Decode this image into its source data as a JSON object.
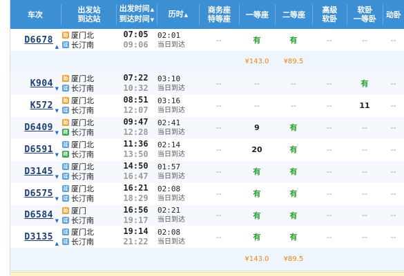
{
  "header": {
    "train_no": "车次",
    "stations_1": "出发站",
    "stations_2": "到达站",
    "times_1": "出发时间",
    "times_2": "到达时间",
    "duration": "历时",
    "business_1": "商务座",
    "business_2": "特等座",
    "first": "一等座",
    "second": "二等座",
    "hsoft_1": "高级",
    "hsoft_2": "软卧",
    "soft_1": "软卧",
    "soft_2": "一等卧",
    "motor": "动卧",
    "sort_up": "▲",
    "sort_down": "▼"
  },
  "badges": {
    "start": "始",
    "pass": "过",
    "end": "终"
  },
  "arrows": {
    "up": "▲",
    "down": "▼"
  },
  "price_rows": [
    {
      "first": "¥143.0",
      "second": "¥89.5"
    },
    {
      "first": "¥143.0",
      "second": "¥89.5"
    }
  ],
  "trains": [
    {
      "no": "D6678",
      "from": "厦门北",
      "to": "长汀南",
      "from_badge": "始",
      "to_badge": "过",
      "dep": "07:05",
      "arr": "09:06",
      "dur": "02:01",
      "day": "当日到达",
      "biz": "--",
      "first": "有",
      "second": "有",
      "hsoft": "--",
      "soft": "--",
      "motor": "--",
      "arrow": "up"
    },
    {
      "no": "K904",
      "from": "厦门北",
      "to": "长汀南",
      "from_badge": "始",
      "to_badge": "过",
      "dep": "07:22",
      "arr": "10:32",
      "dur": "03:10",
      "day": "当日到达",
      "biz": "--",
      "first": "--",
      "second": "--",
      "hsoft": "--",
      "soft": "有",
      "motor": "--",
      "arrow": "down"
    },
    {
      "no": "K572",
      "from": "厦门北",
      "to": "长汀南",
      "from_badge": "始",
      "to_badge": "过",
      "dep": "08:51",
      "arr": "12:07",
      "dur": "03:16",
      "day": "当日到达",
      "biz": "--",
      "first": "--",
      "second": "--",
      "hsoft": "--",
      "soft": "11",
      "motor": "--",
      "arrow": "down"
    },
    {
      "no": "D6409",
      "from": "厦门北",
      "to": "长汀南",
      "from_badge": "始",
      "to_badge": "终",
      "dep": "09:47",
      "arr": "12:28",
      "dur": "02:41",
      "day": "当日到达",
      "biz": "--",
      "first": "9",
      "second": "有",
      "hsoft": "--",
      "soft": "--",
      "motor": "--",
      "arrow": "down"
    },
    {
      "no": "D6591",
      "from": "厦门北",
      "to": "长汀南",
      "from_badge": "过",
      "to_badge": "终",
      "dep": "11:36",
      "arr": "13:50",
      "dur": "02:14",
      "day": "当日到达",
      "biz": "--",
      "first": "20",
      "second": "有",
      "hsoft": "--",
      "soft": "--",
      "motor": "--",
      "arrow": "down"
    },
    {
      "no": "D3145",
      "from": "厦门北",
      "to": "长汀南",
      "from_badge": "过",
      "to_badge": "过",
      "dep": "14:50",
      "arr": "16:47",
      "dur": "01:57",
      "day": "当日到达",
      "biz": "--",
      "first": "有",
      "second": "有",
      "hsoft": "--",
      "soft": "--",
      "motor": "--",
      "arrow": "down"
    },
    {
      "no": "D6575",
      "from": "厦门北",
      "to": "长汀南",
      "from_badge": "过",
      "to_badge": "过",
      "dep": "16:21",
      "arr": "18:29",
      "dur": "02:08",
      "day": "当日到达",
      "biz": "--",
      "first": "有",
      "second": "有",
      "hsoft": "--",
      "soft": "--",
      "motor": "--",
      "arrow": "down"
    },
    {
      "no": "D6584",
      "from": "厦门",
      "to": "长汀南",
      "from_badge": "始",
      "to_badge": "过",
      "dep": "16:56",
      "arr": "19:17",
      "dur": "02:21",
      "day": "当日到达",
      "biz": "--",
      "first": "有",
      "second": "有",
      "hsoft": "--",
      "soft": "--",
      "motor": "--",
      "arrow": "down"
    },
    {
      "no": "D3135",
      "from": "厦门北",
      "to": "长汀南",
      "from_badge": "过",
      "to_badge": "过",
      "dep": "19:14",
      "arr": "21:22",
      "dur": "02:08",
      "day": "当日到达",
      "biz": "--",
      "first": "有",
      "second": "有",
      "hsoft": "--",
      "soft": "--",
      "motor": "--",
      "arrow": "up"
    }
  ]
}
